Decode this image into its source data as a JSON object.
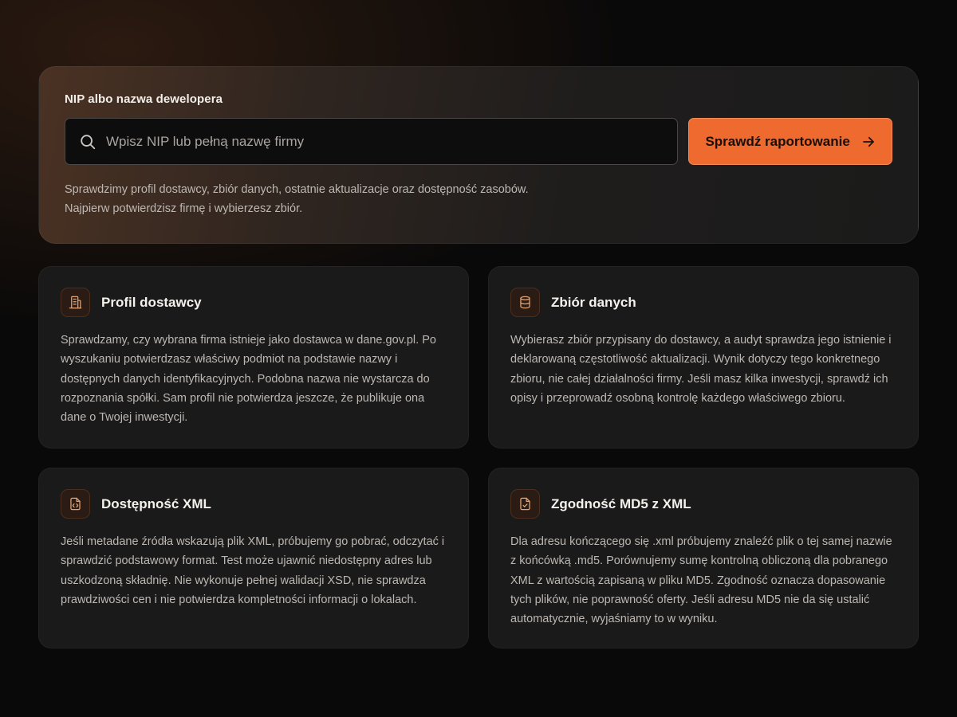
{
  "search": {
    "label": "NIP albo nazwa dewelopera",
    "placeholder": "Wpisz NIP lub pełną nazwę firmy",
    "value": "",
    "submit_label": "Sprawdź raportowanie",
    "helper_line1": "Sprawdzimy profil dostawcy, zbiór danych, ostatnie aktualizacje oraz dostępność zasobów.",
    "helper_line2": "Najpierw potwierdzisz firmę i wybierzesz zbiór."
  },
  "cards": [
    {
      "icon": "building-icon",
      "title": "Profil dostawcy",
      "body": "Sprawdzamy, czy wybrana firma istnieje jako dostawca w dane.gov.pl. Po wyszukaniu potwierdzasz właściwy podmiot na podstawie nazwy i dostępnych danych identyfikacyjnych. Podobna nazwa nie wystarcza do rozpoznania spółki. Sam profil nie potwierdza jeszcze, że publikuje ona dane o Twojej inwestycji."
    },
    {
      "icon": "database-icon",
      "title": "Zbiór danych",
      "body": "Wybierasz zbiór przypisany do dostawcy, a audyt sprawdza jego istnienie i deklarowaną częstotliwość aktualizacji. Wynik dotyczy tego konkretnego zbioru, nie całej działalności firmy. Jeśli masz kilka inwestycji, sprawdź ich opisy i przeprowadź osobną kontrolę każdego właściwego zbioru."
    },
    {
      "icon": "file-code-icon",
      "title": "Dostępność XML",
      "body": "Jeśli metadane źródła wskazują plik XML, próbujemy go pobrać, odczytać i sprawdzić podstawowy format. Test może ujawnić niedostępny adres lub uszkodzoną składnię. Nie wykonuje pełnej walidacji XSD, nie sprawdza prawdziwości cen i nie potwierdza kompletności informacji o lokalach."
    },
    {
      "icon": "file-check-icon",
      "title": "Zgodność MD5 z XML",
      "body": "Dla adresu kończącego się .xml próbujemy znaleźć plik o tej samej nazwie z końcówką .md5. Porównujemy sumę kontrolną obliczoną dla pobranego XML z wartością zapisaną w pliku MD5. Zgodność oznacza dopasowanie tych plików, nie poprawność oferty. Jeśli adresu MD5 nie da się ustalić automatycznie, wyjaśniamy to w wyniku."
    }
  ],
  "colors": {
    "accent": "#ef6a2e",
    "icon_stroke": "#e3a171",
    "card_bg": "#1a1a1a"
  }
}
